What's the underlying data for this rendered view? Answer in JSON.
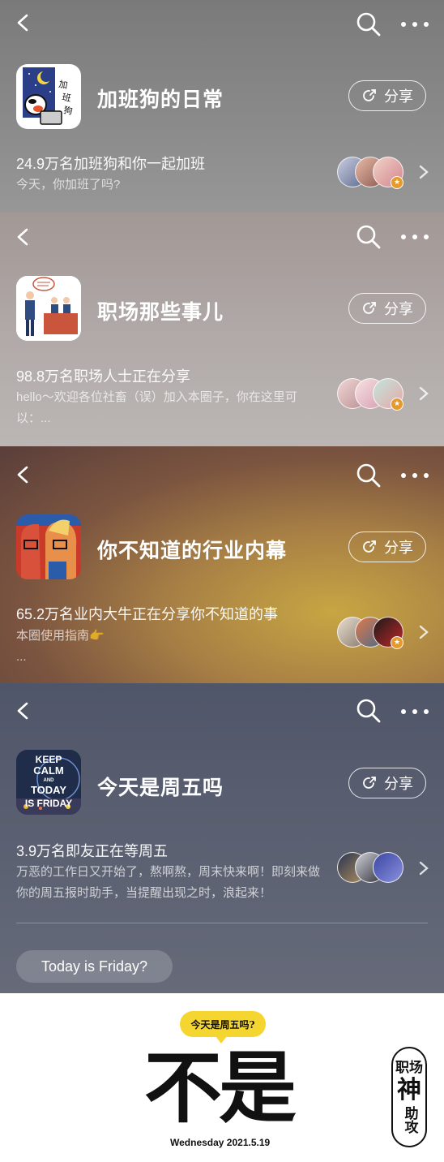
{
  "groups": [
    {
      "name": "加班狗的日常",
      "share_label": "分享",
      "stat": "24.9万名加班狗和你一起加班",
      "desc": "今天，你加班了吗?"
    },
    {
      "name": "职场那些事儿",
      "share_label": "分享",
      "stat": "98.8万名职场人士正在分享",
      "desc": "hello～欢迎各位社畜（误）加入本圈子，你在这里可以：..."
    },
    {
      "name": "你不知道的行业内幕",
      "share_label": "分享",
      "stat": "65.2万名业内大牛正在分享你不知道的事",
      "desc_line1": "本圈使用指南👉",
      "desc_line2": "..."
    },
    {
      "name": "今天是周五吗",
      "share_label": "分享",
      "stat": "3.9万名即友正在等周五",
      "desc": "万恶的工作日又开始了，熬啊熬，周末快来啊！即刻来做你的周五报时助手，当提醒出现之时，浪起来！",
      "logo_text": [
        "KEEP",
        "CALM",
        "AND",
        "TODAY",
        "IS FRIDAY"
      ]
    }
  ],
  "chip_label": "Today is Friday?",
  "poster": {
    "bubble": "今天是周五吗?",
    "answer": "不是",
    "date": "Wednesday 2021.5.19",
    "stamp": [
      "职场",
      "神",
      "助攻"
    ]
  },
  "colors": {
    "badge": "#e59a2b",
    "bubble": "#f5d631"
  },
  "icons": [
    "back-icon",
    "search-icon",
    "more-icon",
    "share-icon",
    "chevron-right-icon"
  ]
}
